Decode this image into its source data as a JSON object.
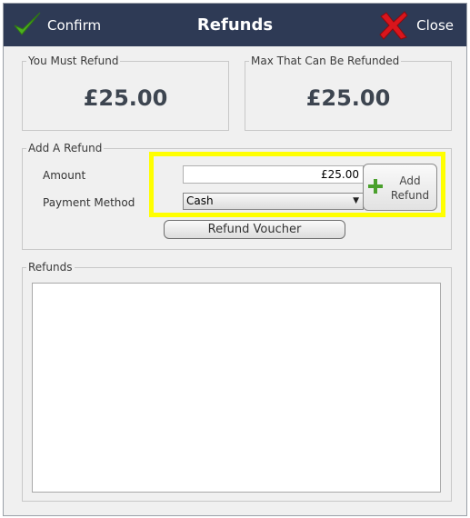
{
  "titlebar": {
    "confirm_label": "Confirm",
    "title": "Refunds",
    "close_label": "Close"
  },
  "summary": {
    "must_refund_label": "You Must Refund",
    "must_refund_value": "£25.00",
    "max_refund_label": "Max That Can Be Refunded",
    "max_refund_value": "£25.00"
  },
  "add_refund": {
    "group_label": "Add A Refund",
    "amount_label": "Amount",
    "amount_value": "£25.00",
    "payment_method_label": "Payment Method",
    "payment_method_selected": "Cash",
    "add_button_label_line1": "Add",
    "add_button_label_line2": "Refund",
    "voucher_button_label": "Refund Voucher"
  },
  "refunds": {
    "group_label": "Refunds",
    "items": []
  },
  "colors": {
    "titlebar_bg": "#2e3a55",
    "highlight": "#ffff00",
    "confirm_icon": "#4caf1f",
    "close_icon": "#d9151c",
    "add_icon": "#4aa02c"
  },
  "icons": {
    "confirm": "checkmark-icon",
    "close": "red-x-icon",
    "add": "plus-icon",
    "dropdown": "chevron-down-icon"
  }
}
